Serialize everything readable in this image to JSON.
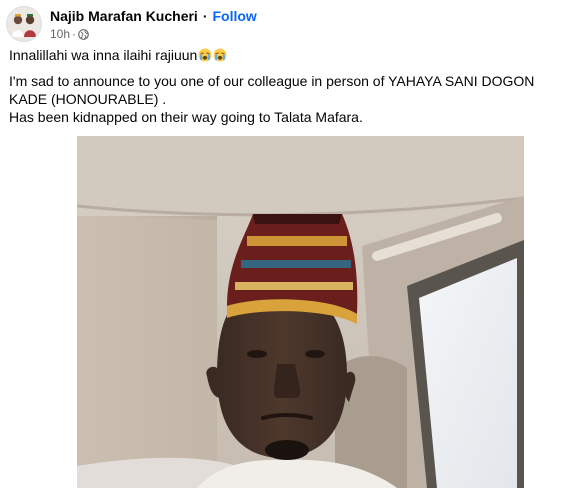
{
  "post": {
    "author_name": "Najib Marafan Kucheri",
    "separator": "·",
    "follow_label": "Follow",
    "timestamp": "10h",
    "meta_separator": "·",
    "audience_icon": "globe-icon",
    "line1": "Innalillahi wa inna ilaihi rajiuun",
    "line1_emojis": [
      "loudly-crying-face-emoji",
      "loudly-crying-face-emoji"
    ],
    "line2": "I'm sad to announce to you one of our colleague in person of YAHAYA SANI DOGON KADE (HONOURABLE) .",
    "line3": "Has been kidnapped on their way going to Talata Mafara.",
    "photo": "selfie of a man in an embroidered cap seated in a car"
  },
  "colors": {
    "follow_link": "#0866ff",
    "meta_text": "#65676b",
    "text": "#050505",
    "emoji_face": "#ffcc4d",
    "emoji_tears": "#5dadec"
  }
}
